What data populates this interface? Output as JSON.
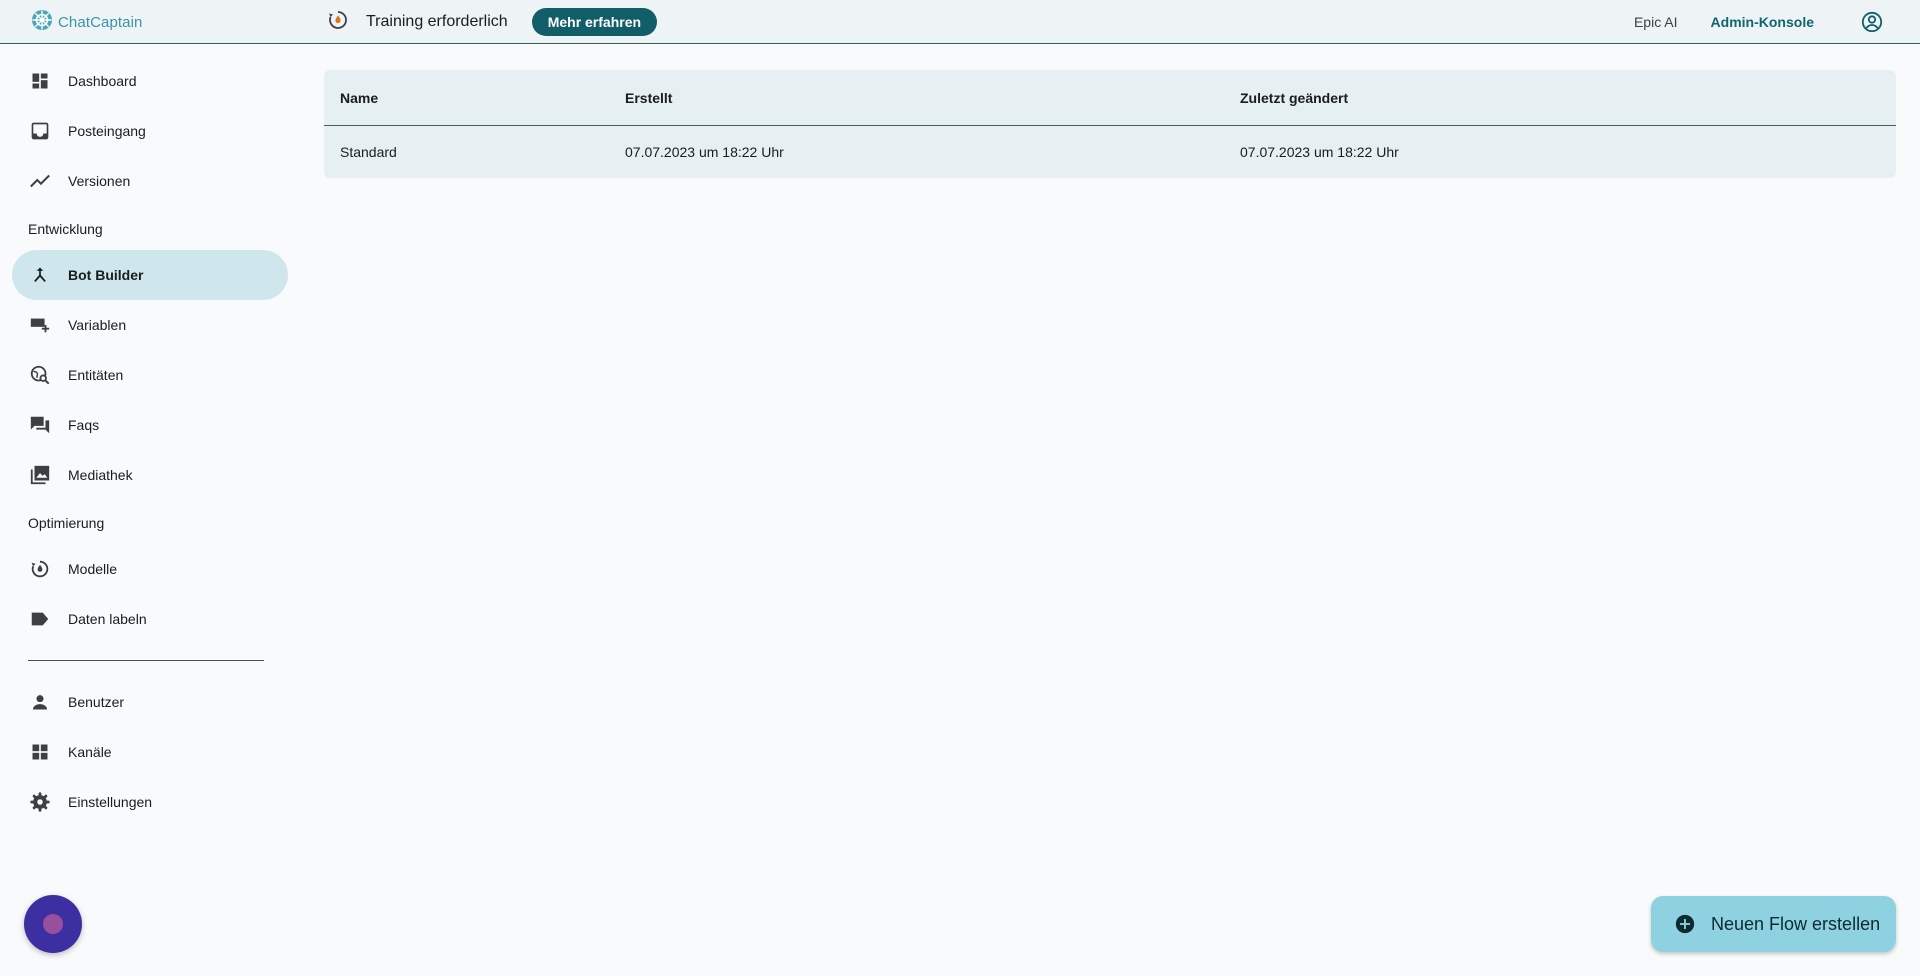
{
  "colors": {
    "accent": "#115e68",
    "active_nav_bg": "#cfe6ec",
    "fab_bg": "#8ed2e2",
    "chat_bubble": "#3b2fa2",
    "logo": "#3b93a8"
  },
  "topbar": {
    "logo": {
      "text": "ChatCaptain",
      "icon": "ship-wheel-icon"
    },
    "training": {
      "icon": "training-required-icon",
      "title": "Training erforderlich",
      "button_label": "Mehr erfahren"
    },
    "links": {
      "epic_ai": "Epic AI",
      "admin_console": "Admin-Konsole"
    },
    "account_icon": "account-circle-icon"
  },
  "sidebar": {
    "items": [
      {
        "label": "Dashboard",
        "icon": "dashboard-icon"
      },
      {
        "label": "Posteingang",
        "icon": "inbox-icon"
      },
      {
        "label": "Versionen",
        "icon": "trending-line-icon"
      },
      {
        "label": "Bot Builder",
        "icon": "merge-flow-icon",
        "active": true
      },
      {
        "label": "Variablen",
        "icon": "add-variable-icon"
      },
      {
        "label": "Entitäten",
        "icon": "travel-explore-icon"
      },
      {
        "label": "Faqs",
        "icon": "forum-icon"
      },
      {
        "label": "Mediathek",
        "icon": "photo-library-icon"
      },
      {
        "label": "Modelle",
        "icon": "model-cycle-icon"
      },
      {
        "label": "Daten labeln",
        "icon": "label-icon"
      },
      {
        "label": "Benutzer",
        "icon": "person-icon"
      },
      {
        "label": "Kanäle",
        "icon": "widgets-icon"
      },
      {
        "label": "Einstellungen",
        "icon": "settings-gear-icon"
      }
    ],
    "sections": {
      "development": "Entwicklung",
      "optimization": "Optimierung"
    }
  },
  "table": {
    "columns": [
      "Name",
      "Erstellt",
      "Zuletzt geändert"
    ],
    "rows": [
      [
        "Standard",
        "07.07.2023 um 18:22 Uhr",
        "07.07.2023 um 18:22 Uhr"
      ]
    ]
  },
  "fab": {
    "label": "Neuen Flow erstellen",
    "icon": "add-circle-icon"
  },
  "chat_widget": {
    "icon": "chat-bubble-icon"
  }
}
